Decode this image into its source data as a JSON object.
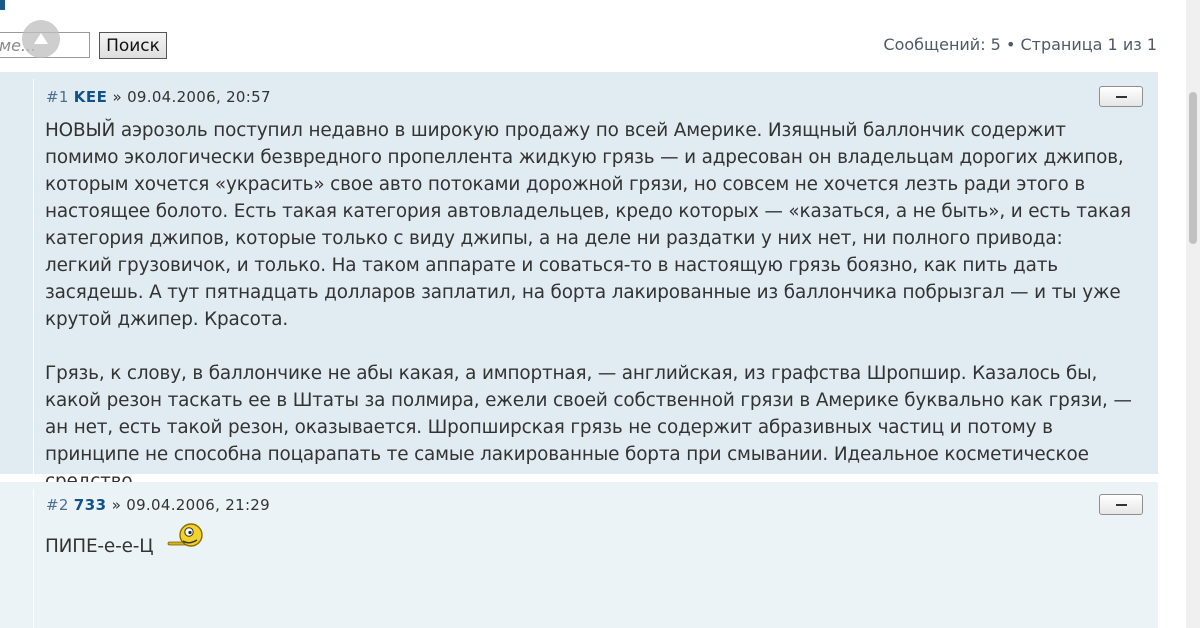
{
  "search": {
    "placeholder": "ме...",
    "button_label": "Поиск"
  },
  "pagination": {
    "text": "Сообщений: 5 • Страница 1 из 1"
  },
  "icons": {
    "scroll_up": "chevron-up-icon",
    "collapse": "minus-icon",
    "smiley": "smiley-icon"
  },
  "colors": {
    "post_bg_1": "#e1ebf2",
    "post_bg_2": "#ecf3f7",
    "author_link": "#105289"
  },
  "posts": [
    {
      "number": "#1",
      "author": "KEE",
      "arrow": "»",
      "date": "09.04.2006, 20:57",
      "paragraphs": [
        "НОВЫЙ аэрозоль поступил недавно в широкую продажу по всей Америке. Изящный баллончик содержит помимо экологически безвредного пропеллента жидкую грязь — и адресован он владельцам дорогих джипов, которым хочется «украсить» свое авто потоками дорожной грязи, но совсем не хочется лезть ради этого в настоящее болото. Есть такая категория автовладельцев, кредо которых — «казаться, а не быть», и есть такая категория джипов, которые только с виду джипы, а на деле ни раздатки у них нет, ни полного привода: легкий грузовичок, и только. На таком аппарате и соваться-то в настоящую грязь боязно, как пить дать засядешь. А тут пятнадцать долларов заплатил, на борта лакированные из баллончика побрызгал — и ты уже крутой джипер. Красота.",
        "Грязь, к слову, в баллончике не абы какая, а импортная, — английская, из графства Шропшир. Казалось бы, какой резон таскать ее в Штаты за полмира, ежели своей собственной грязи в Америке буквально как грязи, — ан нет, есть такой резон, оказывается. Шропширская грязь не содержит абразивных частиц и потому в принципе не способна поцарапать те самые лакированные борта при смывании. Идеальное косметическое средство.\nпо материалам \"авторевю\""
      ]
    },
    {
      "number": "#2",
      "author": "733",
      "arrow": "»",
      "date": "09.04.2006, 21:29",
      "text": "ПИПЕ-е-е-Ц"
    }
  ]
}
